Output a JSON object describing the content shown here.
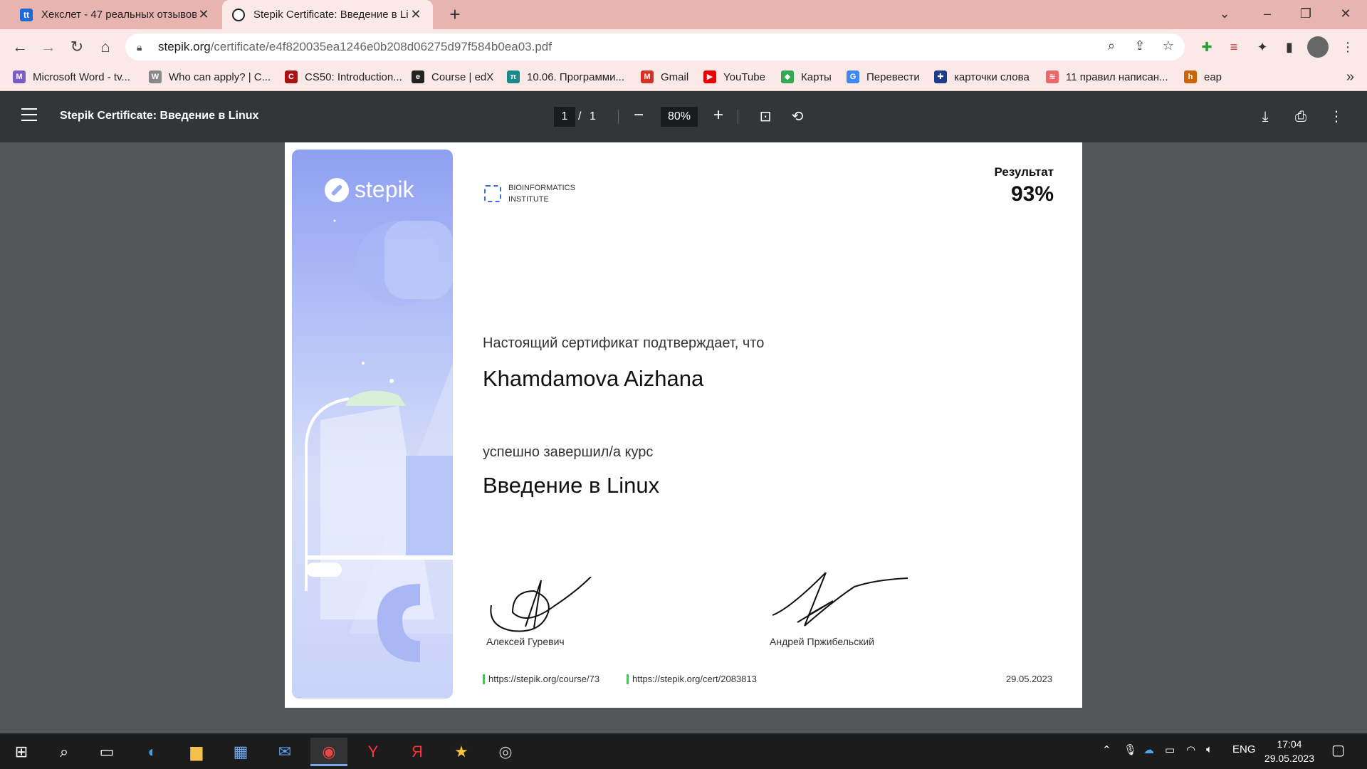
{
  "tabs": [
    {
      "title": "Хекслет - 47 реальных отзывов",
      "icon": "hexlet-icon",
      "favicon": "tt",
      "color": "#1f6bd6"
    },
    {
      "title": "Stepik Certificate: Введение в Li",
      "icon": "stepik-icon"
    }
  ],
  "window": {
    "minimize": "–",
    "restore": "❐",
    "close": "✕"
  },
  "omnibox": {
    "host": "stepik.org",
    "path": "/certificate/e4f820035ea1246e0b208d06275d97f584b0ea03.pdf"
  },
  "bookmarks": [
    {
      "label": "Microsoft Word - tv...",
      "color": "#7a5cc9",
      "glyph": "M"
    },
    {
      "label": "Who can apply? | C...",
      "color": "#888",
      "glyph": "W"
    },
    {
      "label": "CS50: Introduction...",
      "color": "#a11",
      "glyph": "C"
    },
    {
      "label": "Course | edX",
      "color": "#222",
      "glyph": "e"
    },
    {
      "label": "10.06. Программи...",
      "color": "#1d8a8a",
      "glyph": "π"
    },
    {
      "label": "Gmail",
      "color": "#d93025",
      "glyph": "M"
    },
    {
      "label": "YouTube",
      "color": "#e00",
      "glyph": "▶"
    },
    {
      "label": "Карты",
      "color": "#34a853",
      "glyph": "◆"
    },
    {
      "label": "Перевести",
      "color": "#4285f4",
      "glyph": "G"
    },
    {
      "label": "карточки слова",
      "color": "#1a3c8a",
      "glyph": "✚"
    },
    {
      "label": "11 правил написан...",
      "color": "#e66",
      "glyph": "≋"
    },
    {
      "label": "еар",
      "color": "#c60",
      "glyph": "h"
    }
  ],
  "pdf": {
    "title": "Stepik Certificate: Введение в Linux",
    "page_current": "1",
    "page_sep": "/",
    "page_total": "1",
    "zoom": "80%"
  },
  "certificate": {
    "brand": "stepik",
    "org_line1": "BIOINFORMATICS",
    "org_line2": "INSTITUTE",
    "result_label": "Результат",
    "result_value": "93%",
    "confirm_text": "Настоящий сертификат подтверждает, что",
    "student_name": "Khamdamova Aizhana",
    "completed_text": "успешно завершил/а  курс",
    "course_title": "Введение в Linux",
    "signer1": "Алексей Гуревич",
    "signer2": "Андрей Пржибельский",
    "course_url": "https://stepik.org/course/73",
    "cert_url": "https://stepik.org/cert/2083813",
    "date": "29.05.2023"
  },
  "taskbar": {
    "lang": "ENG",
    "time": "17:04",
    "date": "29.05.2023"
  }
}
